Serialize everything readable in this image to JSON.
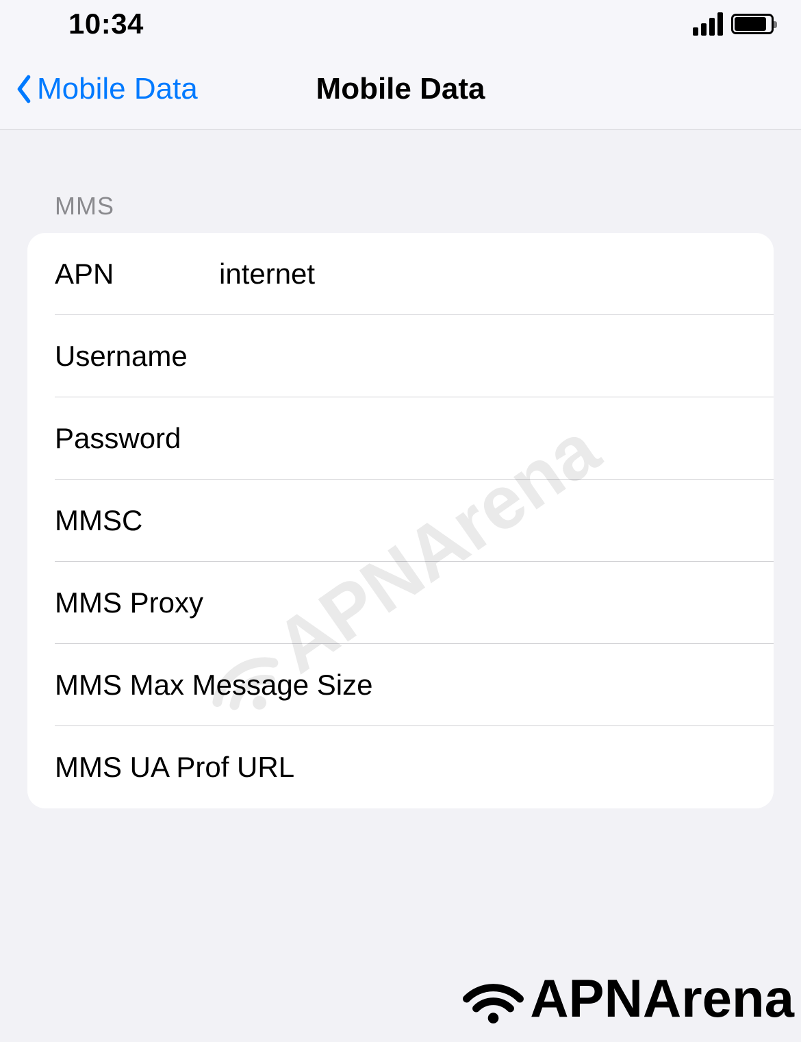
{
  "status": {
    "time": "10:34"
  },
  "nav": {
    "back_label": "Mobile Data",
    "title": "Mobile Data"
  },
  "section": {
    "header": "MMS"
  },
  "fields": {
    "apn": {
      "label": "APN",
      "value": "internet"
    },
    "username": {
      "label": "Username",
      "value": ""
    },
    "password": {
      "label": "Password",
      "value": ""
    },
    "mmsc": {
      "label": "MMSC",
      "value": ""
    },
    "mms_proxy": {
      "label": "MMS Proxy",
      "value": ""
    },
    "mms_max": {
      "label": "MMS Max Message Size",
      "value": ""
    },
    "mms_ua": {
      "label": "MMS UA Prof URL",
      "value": ""
    }
  },
  "watermark": {
    "text": "APNArena"
  }
}
